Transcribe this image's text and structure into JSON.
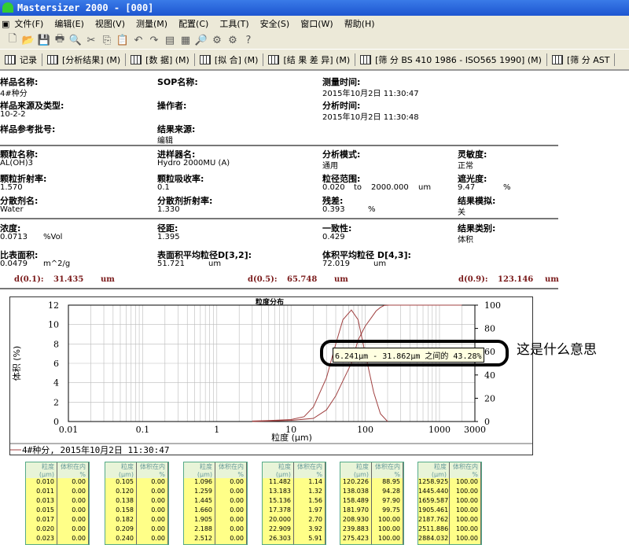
{
  "window": {
    "title": "Mastersizer 2000 - [000]"
  },
  "menu": [
    "文件(F)",
    "编辑(E)",
    "视图(V)",
    "测量(M)",
    "配置(C)",
    "工具(T)",
    "安全(S)",
    "窗口(W)",
    "帮助(H)"
  ],
  "toolbar_icons": [
    "new-icon",
    "open-icon",
    "save-icon",
    "print-icon",
    "print-preview-icon",
    "cut-icon",
    "copy-icon",
    "paste-icon",
    "undo-icon",
    "redo-icon",
    "report-icon",
    "settings-icon",
    "search-icon",
    "gear-icon",
    "gear2-icon",
    "help-icon"
  ],
  "tabs": [
    "记录",
    "[分析结果] (M)",
    "[数 据] (M)",
    "[拟 合] (M)",
    "[结 果 差 异] (M)",
    "[筛 分 BS 410 1986 - ISO565 1990] (M)",
    "[筛 分 AST"
  ],
  "info": {
    "sample_name": {
      "label": "样品名称:",
      "value": "4#种分"
    },
    "sop_name": {
      "label": "SOP名称:",
      "value": ""
    },
    "measure_time": {
      "label": "测量时间:",
      "value": "2015年10月2日 11:30:47"
    },
    "sample_source": {
      "label": "样品来源及类型:",
      "value": "10-2-2"
    },
    "operator": {
      "label": "操作者:",
      "value": ""
    },
    "analysis_time": {
      "label": "分析时间:",
      "value": "2015年10月2日 11:30:48"
    },
    "sample_ref": {
      "label": "样品参考批号:",
      "value": ""
    },
    "result_source": {
      "label": "结果来源:",
      "value": "编辑"
    },
    "particle_name": {
      "label": "颗粒名称:",
      "value": "AL(OH)3"
    },
    "accessory": {
      "label": "进样器名:",
      "value": "Hydro 2000MU (A)"
    },
    "analysis_mode": {
      "label": "分析模式:",
      "value": "通用"
    },
    "sensitivity": {
      "label": "灵敏度:",
      "value": "正常"
    },
    "particle_ri": {
      "label": "颗粒折射率:",
      "value": "1.570"
    },
    "absorption": {
      "label": "颗粒吸收率:",
      "value": "0.1"
    },
    "size_range": {
      "label": "粒径范围:",
      "from": "0.020",
      "to_word": "to",
      "to": "2000.000",
      "unit": "um"
    },
    "obscuration": {
      "label": "遮光度:",
      "value": "9.47",
      "unit": "%"
    },
    "dispersant": {
      "label": "分散剂名:",
      "value": "Water"
    },
    "dispersant_ri": {
      "label": "分散剂折射率:",
      "value": "1.330"
    },
    "residual": {
      "label": "残差:",
      "value": "0.393",
      "unit": "%"
    },
    "emulation": {
      "label": "结果模拟:",
      "value": "关"
    },
    "concentration": {
      "label": "浓度:",
      "value": "0.0713",
      "unit": "%Vol"
    },
    "span": {
      "label": "径距:",
      "value": "1.395"
    },
    "uniformity": {
      "label": "一致性:",
      "value": "0.429"
    },
    "result_units": {
      "label": "结果类别:",
      "value": "体积"
    },
    "ssa": {
      "label": "比表面积:",
      "value": "0.0479",
      "unit": "m^2/g"
    },
    "d32": {
      "label": "表面积平均粒径D[3,2]:",
      "value": "51.721",
      "unit": "um"
    },
    "d43": {
      "label": "体积平均粒径 D[4,3]:",
      "value": "72.019",
      "unit": "um"
    },
    "d10": {
      "label": "d(0.1):",
      "value": "31.435",
      "unit": "um"
    },
    "d50": {
      "label": "d(0.5):",
      "value": "65.748",
      "unit": "um"
    },
    "d90": {
      "label": "d(0.9):",
      "value": "123.146",
      "unit": "um"
    }
  },
  "chart_data": {
    "type": "line",
    "title": "粒度分布",
    "xlabel": "粒度 (μm)",
    "ylabel": "体积 (%)",
    "xscale": "log",
    "xlim": [
      0.01,
      3000
    ],
    "ylim": [
      0,
      12
    ],
    "y2lim": [
      0,
      100
    ],
    "xticks": [
      "0.01",
      "0.1",
      "1",
      "10",
      "100",
      "1000",
      "3000"
    ],
    "yticks": [
      "0",
      "2",
      "4",
      "6",
      "8",
      "10",
      "12"
    ],
    "y2ticks": [
      "0",
      "20",
      "40",
      "60",
      "80",
      "100"
    ],
    "grid": true,
    "color": "#a04040",
    "series": [
      {
        "axis": "left",
        "x": [
          3,
          5,
          10,
          15,
          20,
          30,
          40,
          50,
          65,
          80,
          100,
          130,
          160,
          200
        ],
        "y": [
          0.05,
          0.1,
          0.2,
          0.5,
          1.5,
          4.5,
          8,
          10.5,
          11.5,
          10.5,
          7,
          3,
          0.8,
          0
        ]
      },
      {
        "axis": "right",
        "x": [
          3,
          10,
          20,
          30,
          40,
          50,
          65,
          80,
          100,
          120,
          140,
          160,
          180,
          210,
          2000
        ],
        "y": [
          0,
          1,
          2.7,
          10,
          22,
          35,
          50,
          70,
          82,
          89,
          95,
          98,
          99.75,
          100,
          100
        ]
      }
    ],
    "legend": "4#种分, 2015年10月2日 11:30:47",
    "tooltip": "6.241μm - 31.862μm 之间的 43.28%"
  },
  "annotation": "这是什么意思",
  "tables": {
    "headers": [
      "粒度 (μm)",
      "体积在内 %"
    ],
    "blocks": [
      [
        [
          "0.010",
          "0.00"
        ],
        [
          "0.011",
          "0.00"
        ],
        [
          "0.013",
          "0.00"
        ],
        [
          "0.015",
          "0.00"
        ],
        [
          "0.017",
          "0.00"
        ],
        [
          "0.020",
          "0.00"
        ],
        [
          "0.023",
          "0.00"
        ]
      ],
      [
        [
          "0.105",
          "0.00"
        ],
        [
          "0.120",
          "0.00"
        ],
        [
          "0.138",
          "0.00"
        ],
        [
          "0.158",
          "0.00"
        ],
        [
          "0.182",
          "0.00"
        ],
        [
          "0.209",
          "0.00"
        ],
        [
          "0.240",
          "0.00"
        ]
      ],
      [
        [
          "1.096",
          "0.00"
        ],
        [
          "1.259",
          "0.00"
        ],
        [
          "1.445",
          "0.00"
        ],
        [
          "1.660",
          "0.00"
        ],
        [
          "1.905",
          "0.00"
        ],
        [
          "2.188",
          "0.00"
        ],
        [
          "2.512",
          "0.00"
        ]
      ],
      [
        [
          "11.482",
          "1.14"
        ],
        [
          "13.183",
          "1.32"
        ],
        [
          "15.136",
          "1.56"
        ],
        [
          "17.378",
          "1.97"
        ],
        [
          "20.000",
          "2.70"
        ],
        [
          "22.909",
          "3.92"
        ],
        [
          "26.303",
          "5.91"
        ]
      ],
      [
        [
          "120.226",
          "88.95"
        ],
        [
          "138.038",
          "94.28"
        ],
        [
          "158.489",
          "97.90"
        ],
        [
          "181.970",
          "99.75"
        ],
        [
          "208.930",
          "100.00"
        ],
        [
          "239.883",
          "100.00"
        ],
        [
          "275.423",
          "100.00"
        ]
      ],
      [
        [
          "1258.925",
          "100.00"
        ],
        [
          "1445.440",
          "100.00"
        ],
        [
          "1659.587",
          "100.00"
        ],
        [
          "1905.461",
          "100.00"
        ],
        [
          "2187.762",
          "100.00"
        ],
        [
          "2511.886",
          "100.00"
        ],
        [
          "2884.032",
          "100.00"
        ]
      ]
    ]
  }
}
